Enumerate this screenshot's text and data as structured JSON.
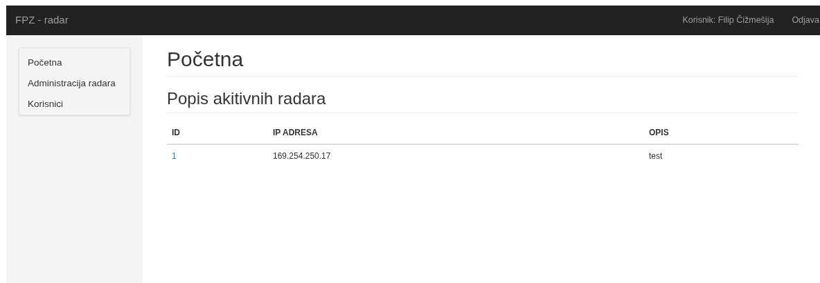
{
  "navbar": {
    "brand": "FPZ - radar",
    "user": "Korisnik: Filip Čižmešija",
    "logout": "Odjava"
  },
  "sidebar": {
    "items": [
      "Početna",
      "Administracija radara",
      "Korisnici"
    ]
  },
  "page_title": "Početna",
  "section_title": "Popis akitivnih radara",
  "table": {
    "columns": [
      "ID",
      "IP ADRESA",
      "OPIS"
    ],
    "rows": [
      {
        "id": "1",
        "ip": "169.254.250.17",
        "description": "test"
      }
    ]
  }
}
